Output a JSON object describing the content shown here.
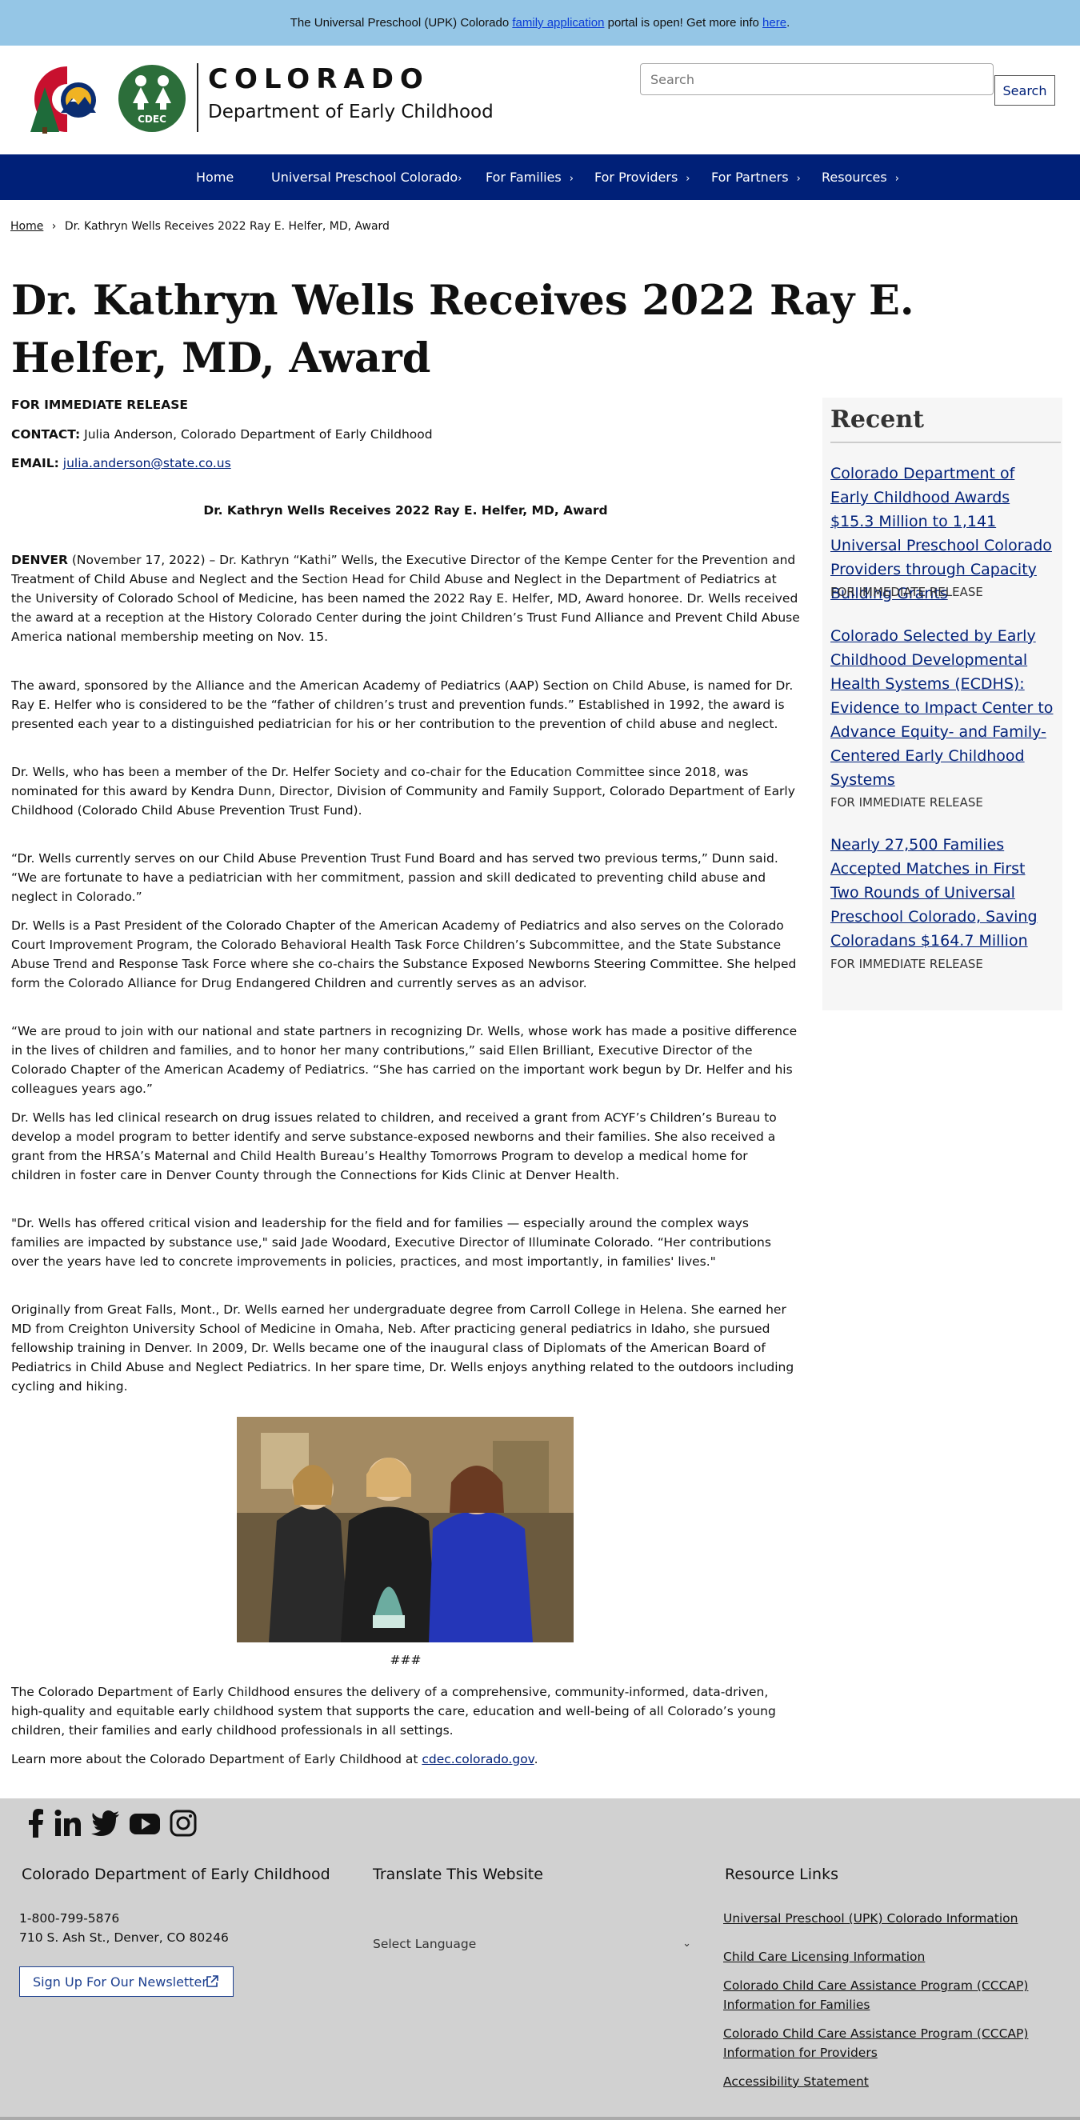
{
  "banner": {
    "prefix": "The Universal Preschool (UPK) Colorado ",
    "link1": "family application",
    "middle": " portal is open! Get more info ",
    "link2": "here",
    "suffix": "."
  },
  "header": {
    "logo_text_colorado": "COLORADO",
    "logo_text_department": "Department of Early Childhood",
    "logo_badge": "CDEC",
    "search_placeholder": "Search",
    "search_button": "Search"
  },
  "nav": {
    "items": [
      {
        "label": "Home"
      },
      {
        "label": "Universal Preschool Colorado"
      },
      {
        "label": "For Families"
      },
      {
        "label": "For Providers"
      },
      {
        "label": "For Partners"
      },
      {
        "label": "Resources"
      }
    ]
  },
  "breadcrumb": {
    "home": "Home",
    "separator": "›",
    "current": "Dr. Kathryn Wells Receives 2022 Ray E. Helfer, MD, Award"
  },
  "article": {
    "title": "Dr. Kathryn Wells Receives 2022 Ray E. Helfer, MD, Award",
    "release": "FOR IMMEDIATE RELEASE",
    "contact_label": "CONTACT:",
    "contact_value": " Julia Anderson, Colorado Department of Early Childhood",
    "email_label": "EMAIL:",
    "email_value": "julia.anderson@state.co.us",
    "subhead": "Dr. Kathryn Wells Receives 2022 Ray E. Helfer, MD, Award",
    "p1_lead": "DENVER",
    "p1": " (November 17, 2022) – Dr. Kathryn “Kathi” Wells, the Executive Director of the Kempe Center for the Prevention and Treatment of Child Abuse and Neglect and the Section Head for Child Abuse and Neglect in the Department of Pediatrics at the University of Colorado School of Medicine, has been named the 2022 Ray E. Helfer, MD, Award honoree. Dr. Wells received the award at a reception at the History Colorado Center during the joint Children’s Trust Fund Alliance and Prevent Child Abuse America national membership meeting on Nov. 15.",
    "p2": "The award, sponsored by the Alliance and the American Academy of Pediatrics (AAP) Section on Child Abuse, is named for Dr. Ray E. Helfer who is considered to be the “father of children’s trust and prevention funds.” Established in 1992, the award is presented each year to a distinguished pediatrician for his or her contribution to the prevention of child abuse and neglect.",
    "p3": "Dr. Wells, who has been a member of the Dr. Helfer Society and co-chair for the Education Committee since 2018, was nominated for this award by Kendra Dunn, Director, Division of Community and Family Support, Colorado Department of Early Childhood (Colorado Child Abuse Prevention Trust Fund).",
    "p4": "“Dr. Wells currently serves on our Child Abuse Prevention Trust Fund Board and has served two previous terms,” Dunn said. “We are fortunate to have a pediatrician with her commitment, passion and skill dedicated to preventing child abuse and neglect in Colorado.”",
    "p5": "Dr. Wells is a Past President of the Colorado Chapter of the American Academy of Pediatrics and also serves on the Colorado Court Improvement Program, the Colorado Behavioral Health Task Force Children’s Subcommittee, and the State Substance Abuse Trend and Response Task Force where she co-chairs the Substance Exposed Newborns Steering Committee. She helped form the Colorado Alliance for Drug Endangered Children and currently serves as an advisor.",
    "p6": "“We are proud to join with our national and state partners in recognizing Dr. Wells, whose work has made a positive difference in the lives of children and families, and to honor her many contributions,” said Ellen Brilliant, Executive Director of the Colorado Chapter of the American Academy of Pediatrics. “She has carried on the important work begun by Dr. Helfer and his colleagues years ago.”",
    "p7": "Dr. Wells has led clinical research on drug issues related to children, and received a grant from ACYF’s Children’s Bureau to develop a model program to better identify and serve substance-exposed newborns and their families. She also received a grant from the HRSA’s Maternal and Child Health Bureau’s Healthy Tomorrows Program to develop a medical home for children in foster care in Denver County through the Connections for Kids Clinic at Denver Health.",
    "p8": "\"Dr. Wells has offered critical vision and leadership for the field and for families — especially around the complex ways families are impacted by substance use,\" said Jade Woodard, Executive Director of Illuminate Colorado. “Her contributions over the years have led to concrete improvements in policies, practices, and most importantly, in families' lives.\"",
    "p9": "Originally from Great Falls, Mont., Dr. Wells earned her undergraduate degree from Carroll College in Helena. She earned her MD from Creighton University School of Medicine in Omaha, Neb. After practicing general pediatrics in Idaho, she pursued fellowship training in Denver. In 2009, Dr. Wells became one of the inaugural class of Diplomats of the American Board of Pediatrics in Child Abuse and Neglect Pediatrics. In her spare time, Dr. Wells enjoys anything related to the outdoors including cycling and hiking.",
    "hash": "###",
    "p10": "The Colorado Department of Early Childhood ensures the delivery of a comprehensive, community-informed, data-driven, high-quality and equitable early childhood system that supports the care, education and well-being of all Colorado’s young children, their families and early childhood professionals in all settings.",
    "p11_prefix": "Learn more about the Colorado Department of Early Childhood at ",
    "p11_link": "cdec.colorado.gov",
    "p11_suffix": "."
  },
  "sidebar": {
    "title": "Recent",
    "items": [
      {
        "title": "Colorado Department of Early Childhood Awards $15.3 Million to 1,141 Universal Preschool Colorado Providers through Capacity Building Grants",
        "meta": "FOR IMMEDIATE RELEASE"
      },
      {
        "title": "Colorado Selected by Early Childhood Developmental Health Systems (ECDHS): Evidence to Impact Center to Advance Equity- and Family-Centered Early Childhood Systems",
        "meta": "FOR IMMEDIATE RELEASE"
      },
      {
        "title": "Nearly 27,500 Families Accepted Matches in First Two Rounds of Universal Preschool Colorado, Saving Coloradans $164.7 Million",
        "meta": "FOR IMMEDIATE RELEASE"
      }
    ]
  },
  "footer": {
    "col1_title": "Colorado Department of Early Childhood",
    "phone": "1-800-799-5876",
    "address": "710 S. Ash St., Denver, CO 80246",
    "newsletter": "Sign Up For Our Newsletter",
    "col2_title": "Translate This Website",
    "language_select": "Select Language",
    "col3_title": "Resource Links",
    "links": [
      "Universal Preschool (UPK) Colorado Information",
      "Child Care Licensing Information",
      "Colorado Child Care Assistance Program (CCCAP) Information for Families",
      "Colorado Child Care Assistance Program (CCCAP) Information for Providers",
      "Accessibility Statement"
    ],
    "social_icons": [
      "facebook-icon",
      "linkedin-icon",
      "twitter-icon",
      "youtube-icon",
      "instagram-icon"
    ]
  },
  "colors": {
    "banner": "#95c6e6",
    "nav": "#002078",
    "link": "#002078",
    "footer": "#d1d1d1",
    "sidebar": "#f6f6f6"
  }
}
